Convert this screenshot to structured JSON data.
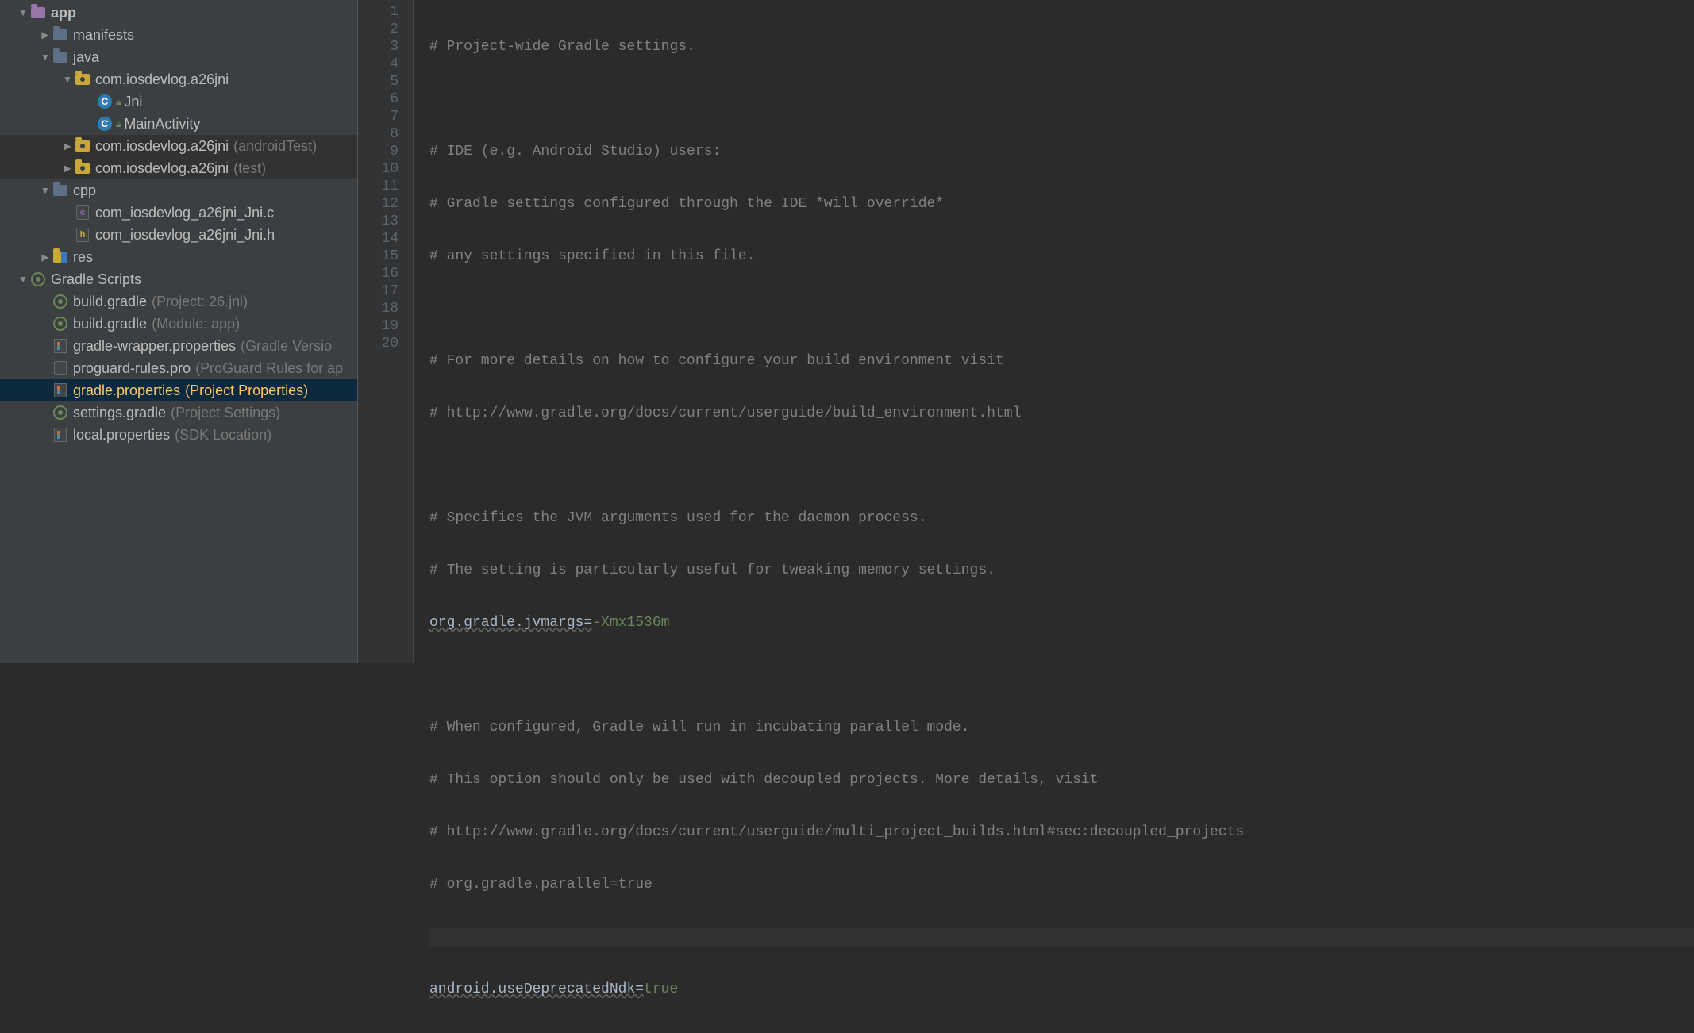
{
  "tree": {
    "app": "app",
    "manifests": "manifests",
    "java": "java",
    "pkg_main": "com.iosdevlog.a26jni",
    "jni": "Jni",
    "main_activity": "MainActivity",
    "pkg_android_test": "com.iosdevlog.a26jni",
    "pkg_android_test_hint": "(androidTest)",
    "pkg_test": "com.iosdevlog.a26jni",
    "pkg_test_hint": "(test)",
    "cpp": "cpp",
    "cfile": "com_iosdevlog_a26jni_Jni.c",
    "hfile": "com_iosdevlog_a26jni_Jni.h",
    "res": "res",
    "gradle_scripts": "Gradle Scripts",
    "build_gradle_project": "build.gradle",
    "build_gradle_project_hint": "(Project: 26.jni)",
    "build_gradle_module": "build.gradle",
    "build_gradle_module_hint": "(Module: app)",
    "gradle_wrapper": "gradle-wrapper.properties",
    "gradle_wrapper_hint": "(Gradle Versio",
    "proguard": "proguard-rules.pro",
    "proguard_hint": "(ProGuard Rules for ap",
    "gradle_properties": "gradle.properties",
    "gradle_properties_hint": "(Project Properties)",
    "settings_gradle": "settings.gradle",
    "settings_gradle_hint": "(Project Settings)",
    "local_properties": "local.properties",
    "local_properties_hint": "(SDK Location)"
  },
  "code": {
    "l1": "# Project-wide Gradle settings.",
    "l2": "",
    "l3": "# IDE (e.g. Android Studio) users:",
    "l4": "# Gradle settings configured through the IDE *will override*",
    "l5": "# any settings specified in this file.",
    "l6": "",
    "l7": "# For more details on how to configure your build environment visit",
    "l8": "# http://www.gradle.org/docs/current/userguide/build_environment.html",
    "l9": "",
    "l10": "# Specifies the JVM arguments used for the daemon process.",
    "l11": "# The setting is particularly useful for tweaking memory settings.",
    "l12k": "org.gradle.jvmargs=",
    "l12v": "-Xmx1536m",
    "l13": "",
    "l14": "# When configured, Gradle will run in incubating parallel mode.",
    "l15": "# This option should only be used with decoupled projects. More details, visit",
    "l16": "# http://www.gradle.org/docs/current/userguide/multi_project_builds.html#sec:decoupled_projects",
    "l17": "# org.gradle.parallel=true",
    "l18": "",
    "l19k": "android.useDeprecatedNdk=",
    "l19v": "true"
  },
  "gutter": [
    "1",
    "2",
    "3",
    "4",
    "5",
    "6",
    "7",
    "8",
    "9",
    "10",
    "11",
    "12",
    "13",
    "14",
    "15",
    "16",
    "17",
    "18",
    "19",
    "20"
  ]
}
